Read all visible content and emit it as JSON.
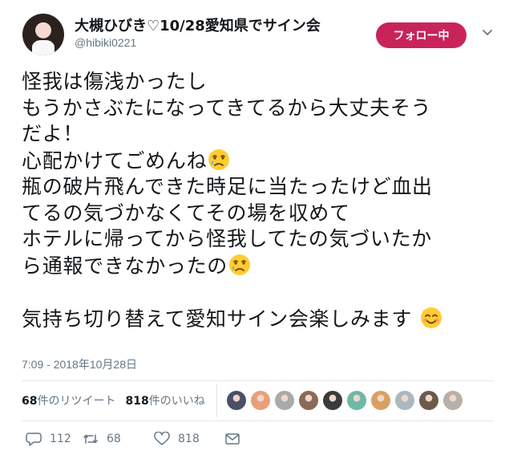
{
  "user": {
    "display_name": "大槻ひびき♡10/28愛知県でサイン会",
    "handle": "@hibiki0221",
    "follow_label": "フォロー中"
  },
  "tweet": {
    "lines": [
      "怪我は傷浅かったし",
      "もうかさぶたになってきてるから大丈夫そう",
      "だよ！",
      "心配かけてごめんね",
      "瓶の破片飛んできた時足に当たったけど血出",
      "てるの気づかなくてその場を収めて",
      "ホテルに帰ってから怪我してたの気づいたか",
      "ら通報できなかったの",
      "",
      "気持ち切り替えて愛知サイン会楽しみます"
    ],
    "emoji": {
      "line4": "crying-face",
      "line8": "crying-face",
      "line10": "smiling-face-with-smiling-eyes"
    },
    "timestamp": "7:09 - 2018年10月28日"
  },
  "stats": {
    "retweets_count": "68",
    "retweets_label": "件のリツイート",
    "likes_count": "818",
    "likes_label": "件のいいね"
  },
  "likers": [
    {
      "name": "liker-1",
      "color": "#4a4f6a"
    },
    {
      "name": "liker-2",
      "color": "#e8a07a"
    },
    {
      "name": "liker-3",
      "color": "#a9a9a9"
    },
    {
      "name": "liker-4",
      "color": "#8b6a55"
    },
    {
      "name": "liker-5",
      "color": "#3b3b3b"
    },
    {
      "name": "liker-6",
      "color": "#6fb8a6"
    },
    {
      "name": "liker-7",
      "color": "#d9a063"
    },
    {
      "name": "liker-8",
      "color": "#aab8c2"
    },
    {
      "name": "liker-9",
      "color": "#6d5a4a"
    },
    {
      "name": "liker-10",
      "color": "#b7b0a8"
    }
  ],
  "actions": {
    "replies": "112",
    "retweets": "68",
    "likes": "818"
  },
  "colors": {
    "follow_button": "#c8245a",
    "text": "#14171a",
    "muted": "#657786",
    "divider": "#e1e8ed"
  }
}
